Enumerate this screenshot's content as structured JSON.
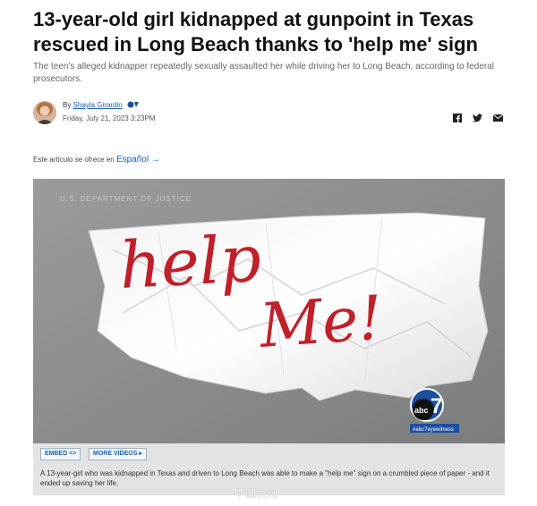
{
  "article": {
    "headline": "13-year-old girl kidnapped at gunpoint in Texas rescued in Long Beach thanks to 'help me' sign",
    "subhead": "The teen's alleged kidnapper repeatedly sexually assaulted her while driving her to Long Beach, according to federal prosecutors.",
    "byline_prefix": "By",
    "author": "Shayla Girardin",
    "date": "Friday, July 21, 2023 3:23PM"
  },
  "share": {
    "icons": [
      "facebook-icon",
      "twitter-icon",
      "email-icon"
    ]
  },
  "language_notice": {
    "text": "Este artículo se ofrece en",
    "link": "Español",
    "arrow": "→"
  },
  "media": {
    "source_credit": "U.S. DEPARTMENT OF JUSTICE",
    "note_text_line1": "help",
    "note_text_line2": "Me!",
    "station_logo_text": "abc",
    "station_number": "7",
    "hashtag": "#abc7eyewitness",
    "embed_label": "EMBED <>",
    "more_videos_label": "MORE VIDEOS",
    "caption": "A 13-year-girl who was kidnapped in Texas and driven to Long Beach was able to make a \"help me\" sign on a crumbled piece of paper - and it ended up saving her life."
  },
  "watermark": "中国侨网",
  "colors": {
    "link": "#1a5fb4",
    "note_ink": "#c0202a",
    "abc_blue": "#1d4f9e"
  }
}
